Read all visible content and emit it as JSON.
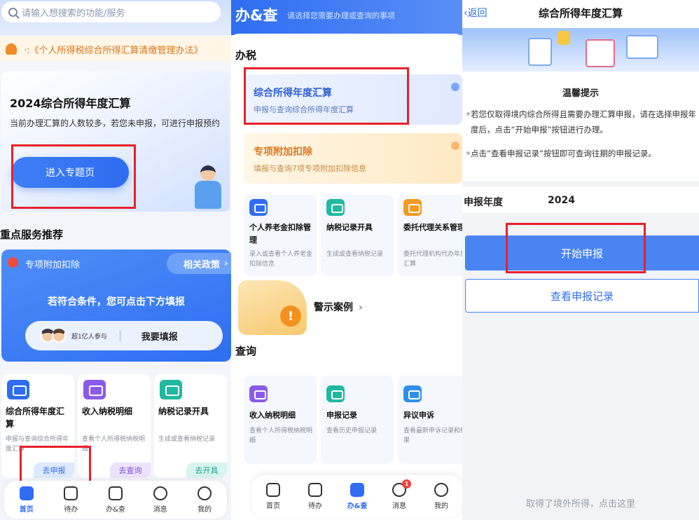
{
  "home": {
    "search_placeholder": "请输入想搜索的功能/服务",
    "notice_text": "·:《个人所得税综合所得汇算清缴管理办法》",
    "banner": {
      "title": "2024综合所得年度汇算",
      "desc": "当前办理汇算的人数较多，若您未申报，可进行申报预约",
      "button": "进入专题页"
    },
    "section_title": "重点服务推荐",
    "promo": {
      "title": "专项附加扣除",
      "policy": "相关政策",
      "hint": "若符合条件，您可点击下方填报",
      "participants": "超1亿人参与",
      "action": "我要填报"
    },
    "services": [
      {
        "name": "综合所得年度汇算",
        "desc": "申报与查询综合所得年度汇算",
        "tag": "去申报",
        "color": "#2f6df2",
        "tag_bg": "#dce9ff",
        "tag_color": "#2f6df2"
      },
      {
        "name": "收入纳税明细",
        "desc": "查看个人所得税纳税明细",
        "tag": "去查询",
        "color": "#8a5be8",
        "tag_bg": "#ece3fb",
        "tag_color": "#7a4fd6"
      },
      {
        "name": "纳税记录开具",
        "desc": "生成或查看纳税记录",
        "tag": "去开具",
        "color": "#20b9a0",
        "tag_bg": "#d8f4ee",
        "tag_color": "#15a58c"
      }
    ],
    "tabs": [
      {
        "label": "首页",
        "icon": "home-icon"
      },
      {
        "label": "待办",
        "icon": "todo-icon"
      },
      {
        "label": "办&查",
        "icon": "handle-query-icon"
      },
      {
        "label": "消息",
        "icon": "message-icon"
      },
      {
        "label": "我的",
        "icon": "profile-icon"
      }
    ]
  },
  "handle": {
    "title": "办&查",
    "subtitle": "请选择您需要办理或查询的事项",
    "section_tax": "办税",
    "feature_main": {
      "name": "综合所得年度汇算",
      "desc": "申报与查询综合所得年度汇算"
    },
    "feature_special": {
      "name": "专项附加扣除",
      "desc": "填报与查询7项专项附加扣除信息"
    },
    "minis": [
      {
        "name": "个人养老金扣除管理",
        "desc": "录入或查看个人养老金扣除信息",
        "color": "#2f6df2"
      },
      {
        "name": "纳税记录开具",
        "desc": "生成或查看纳税记录",
        "color": "#20b9a0"
      },
      {
        "name": "委托代理关系管理",
        "desc": "委托代理机构代办年度汇算",
        "color": "#f49a22"
      }
    ],
    "warning": "警示案例",
    "section_query": "查询",
    "queries": [
      {
        "name": "收入纳税明细",
        "desc": "查看个人所得税纳税明细",
        "color": "#8a5be8"
      },
      {
        "name": "申报记录",
        "desc": "查看历史申报记录",
        "color": "#20b9a0"
      },
      {
        "name": "异议申诉",
        "desc": "查看最新申诉记录和结果",
        "color": "#2f8fe8"
      }
    ],
    "tabs": [
      {
        "label": "首页",
        "icon": "home-icon"
      },
      {
        "label": "待办",
        "icon": "todo-icon"
      },
      {
        "label": "办&查",
        "icon": "handle-query-icon"
      },
      {
        "label": "消息",
        "icon": "message-icon",
        "badge": "1"
      },
      {
        "label": "我的",
        "icon": "profile-icon"
      }
    ]
  },
  "annual": {
    "back": "返回",
    "title": "综合所得年度汇算",
    "tip_title": "温馨提示",
    "tip1": "若您仅取得境内综合所得且需要办理汇算申报，请在选择申报年度后，点击“开始申报”按钮进行办理。",
    "tip2": "点击“查看申报记录”按钮即可查询往期的申报记录。",
    "year_label": "申报年度",
    "year_value": "2024",
    "start_button": "开始申报",
    "records_button": "查看申报记录",
    "foreign_link": "取得了境外所得，点击这里"
  }
}
